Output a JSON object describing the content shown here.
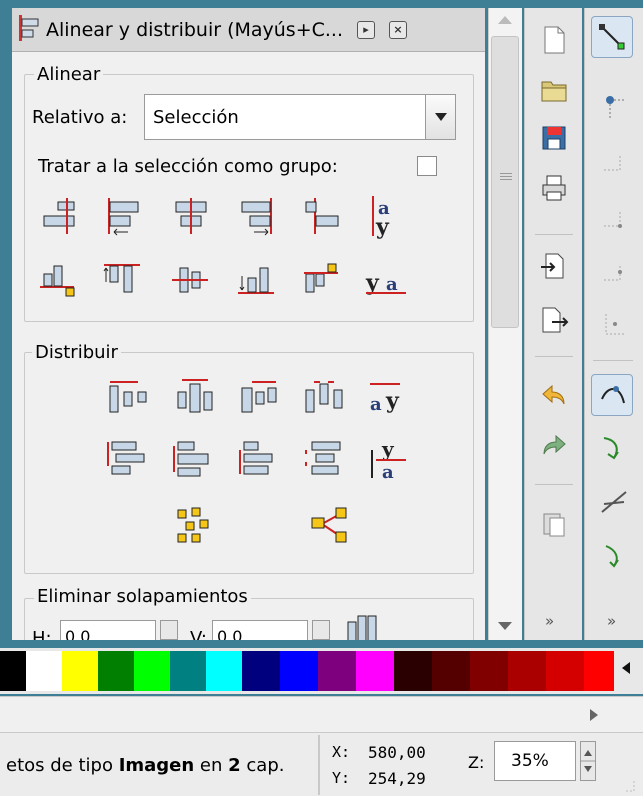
{
  "panel": {
    "title": "Alinear y distribuir (Mayús+C...",
    "align_section": {
      "legend": "Alinear",
      "relative_label": "Relativo a:",
      "relative_value": "Selección",
      "group_label": "Tratar a la selección como grupo:"
    },
    "distribute_section": {
      "legend": "Distribuir"
    },
    "overlap_section": {
      "legend": "Eliminar solapamientos",
      "h_label": "H:",
      "h_value": "0,0",
      "v_label": "V:",
      "v_value": "0,0"
    }
  },
  "toolbar_overflow": "»",
  "commands_overflow": "»",
  "palette": {
    "colors": [
      "#000000",
      "#ffffff",
      "#ffff00",
      "#007f00",
      "#00ff00",
      "#008080",
      "#00ffff",
      "#00007f",
      "#0000ff",
      "#7f007f",
      "#ff00ff",
      "#2a0000",
      "#550000",
      "#800000",
      "#aa0000",
      "#d40000",
      "#ff0000"
    ]
  },
  "status": {
    "msg_prefix": "etos de tipo ",
    "msg_bold1": "Imagen",
    "msg_mid": " en ",
    "msg_bold2": "2",
    "msg_suffix": " cap.",
    "x_label": "X:",
    "x_value": "580,00",
    "y_label": "Y:",
    "y_value": "254,29",
    "z_label": "Z:",
    "zoom": "35%"
  }
}
